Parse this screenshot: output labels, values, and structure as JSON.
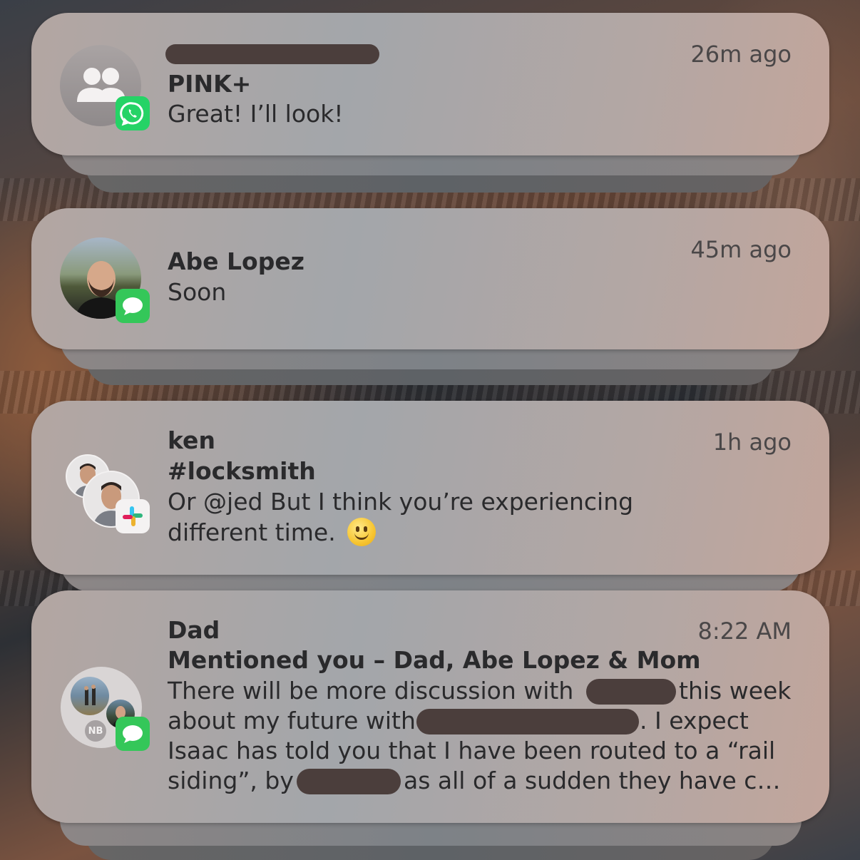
{
  "colors": {
    "whatsapp_green": "#25D366",
    "messages_green": "#34C759",
    "card_bg": "#afa7a6",
    "text_primary": "#2a2a2c",
    "text_time": "#4a4748"
  },
  "notifications": [
    {
      "app_icon": "whatsapp-icon",
      "avatar_icon": "group-icon",
      "sender_redacted": true,
      "title": "PINK+",
      "body": [
        "Great! I’ll look!"
      ],
      "time": "26m ago"
    },
    {
      "app_icon": "messages-icon",
      "avatar_icon": "contact-photo",
      "sender": "Abe Lopez",
      "body": [
        "Soon"
      ],
      "time": "45m ago"
    },
    {
      "app_icon": "slack-icon",
      "avatar_icon": "stacked-contact-photos",
      "sender": "ken",
      "title": "#locksmith",
      "body": [
        "Or @jed But I think you’re experiencing",
        "different time."
      ],
      "emoji": "slightly-smiling-face",
      "time": "1h ago"
    },
    {
      "app_icon": "messages-icon",
      "avatar_icon": "group-photo-collage",
      "avatar_initials": "NB",
      "sender": "Dad",
      "title": "Mentioned you – Dad, Abe Lopez & Mom",
      "body_parts": {
        "l1a": "There will be more discussion with",
        "l1b": "this week",
        "l2a": "about my future with",
        "l2b": ". I expect",
        "l3": "Isaac has told you that I have been routed to a “rail",
        "l4a": "siding”, by",
        "l4b": "as all of a sudden they have c…"
      },
      "time": "8:22 AM"
    }
  ]
}
